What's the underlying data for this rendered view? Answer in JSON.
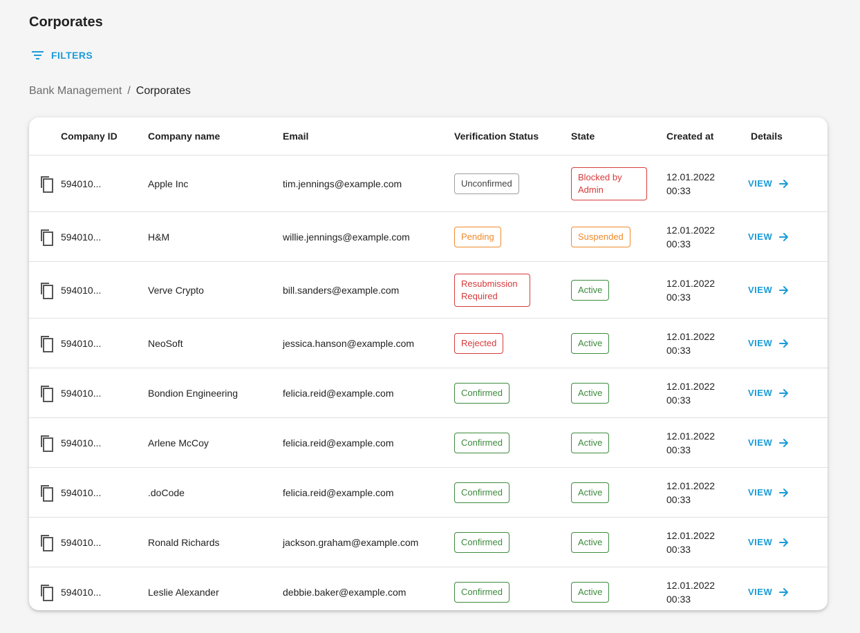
{
  "page": {
    "title": "Corporates"
  },
  "filters": {
    "label": "FILTERS",
    "icon": "filter-icon"
  },
  "breadcrumb": {
    "parent": "Bank Management",
    "separator": "/",
    "current": "Corporates"
  },
  "colors": {
    "accent": "#1a9bd7",
    "grey": "#9e9e9e",
    "orange": "#ef8a2a",
    "red": "#d63a3a",
    "green": "#3c8a3c"
  },
  "table": {
    "headers": [
      "Company ID",
      "Company name",
      "Email",
      "Verification Status",
      "State",
      "Created at",
      "Details"
    ],
    "view_label": "VIEW",
    "rows": [
      {
        "id": "594010...",
        "name": "Apple Inc",
        "email": "tim.jennings@example.com",
        "verification": "Unconfirmed",
        "verification_color": "grey",
        "state": "Blocked by Admin",
        "state_color": "red",
        "created_date": "12.01.2022",
        "created_time": "00:33"
      },
      {
        "id": "594010...",
        "name": "H&M",
        "email": "willie.jennings@example.com",
        "verification": "Pending",
        "verification_color": "orange",
        "state": "Suspended",
        "state_color": "orange",
        "created_date": "12.01.2022",
        "created_time": "00:33"
      },
      {
        "id": "594010...",
        "name": "Verve Crypto",
        "email": "bill.sanders@example.com",
        "verification": "Resubmission Required",
        "verification_color": "red",
        "state": "Active",
        "state_color": "green",
        "created_date": "12.01.2022",
        "created_time": "00:33"
      },
      {
        "id": "594010...",
        "name": "NeoSoft",
        "email": "jessica.hanson@example.com",
        "verification": "Rejected",
        "verification_color": "red",
        "state": "Active",
        "state_color": "green",
        "created_date": "12.01.2022",
        "created_time": "00:33"
      },
      {
        "id": "594010...",
        "name": "Bondion Engineering",
        "email": "felicia.reid@example.com",
        "verification": "Confirmed",
        "verification_color": "green",
        "state": "Active",
        "state_color": "green",
        "created_date": "12.01.2022",
        "created_time": "00:33"
      },
      {
        "id": "594010...",
        "name": "Arlene McCoy",
        "email": "felicia.reid@example.com",
        "verification": "Confirmed",
        "verification_color": "green",
        "state": "Active",
        "state_color": "green",
        "created_date": "12.01.2022",
        "created_time": "00:33"
      },
      {
        "id": "594010...",
        "name": ".doCode",
        "email": "felicia.reid@example.com",
        "verification": "Confirmed",
        "verification_color": "green",
        "state": "Active",
        "state_color": "green",
        "created_date": "12.01.2022",
        "created_time": "00:33"
      },
      {
        "id": "594010...",
        "name": "Ronald Richards",
        "email": "jackson.graham@example.com",
        "verification": "Confirmed",
        "verification_color": "green",
        "state": "Active",
        "state_color": "green",
        "created_date": "12.01.2022",
        "created_time": "00:33"
      },
      {
        "id": "594010...",
        "name": "Leslie Alexander",
        "email": "debbie.baker@example.com",
        "verification": "Confirmed",
        "verification_color": "green",
        "state": "Active",
        "state_color": "green",
        "created_date": "12.01.2022",
        "created_time": "00:33"
      }
    ]
  }
}
